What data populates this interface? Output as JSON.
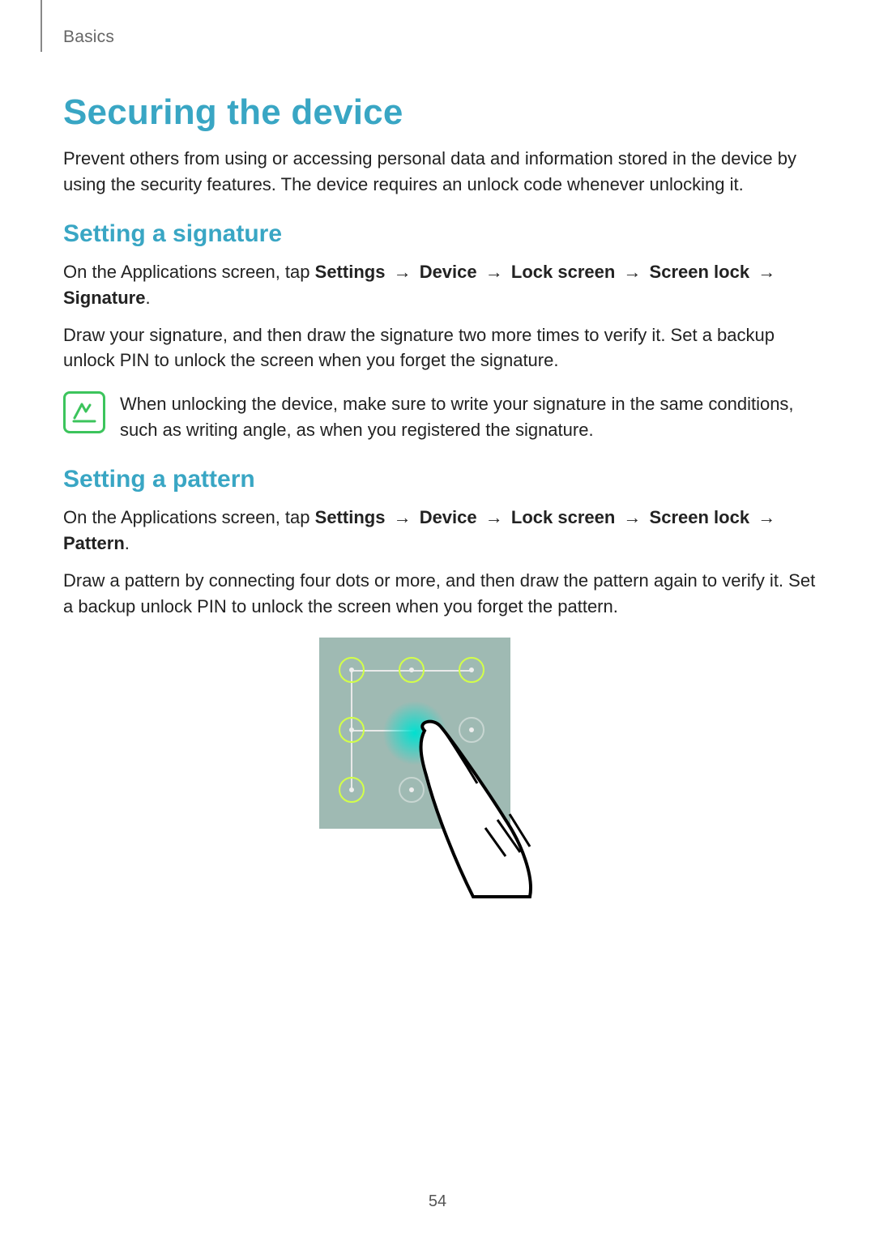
{
  "header": {
    "section_label": "Basics"
  },
  "title": "Securing the device",
  "intro": "Prevent others from using or accessing personal data and information stored in the device by using the security features. The device requires an unlock code whenever unlocking it.",
  "sections": {
    "signature": {
      "heading": "Setting a signature",
      "path_prefix": "On the Applications screen, tap ",
      "path_items": [
        "Settings",
        "Device",
        "Lock screen",
        "Screen lock",
        "Signature"
      ],
      "path_suffix": ".",
      "arrow": "→",
      "body": "Draw your signature, and then draw the signature two more times to verify it. Set a backup unlock PIN to unlock the screen when you forget the signature.",
      "note": "When unlocking the device, make sure to write your signature in the same conditions, such as writing angle, as when you registered the signature."
    },
    "pattern": {
      "heading": "Setting a pattern",
      "path_prefix": "On the Applications screen, tap ",
      "path_items": [
        "Settings",
        "Device",
        "Lock screen",
        "Screen lock",
        "Pattern"
      ],
      "path_suffix": ".",
      "arrow": "→",
      "body": "Draw a pattern by connecting four dots or more, and then draw the pattern again to verify it. Set a backup unlock PIN to unlock the screen when you forget the pattern."
    }
  },
  "page_number": "54"
}
